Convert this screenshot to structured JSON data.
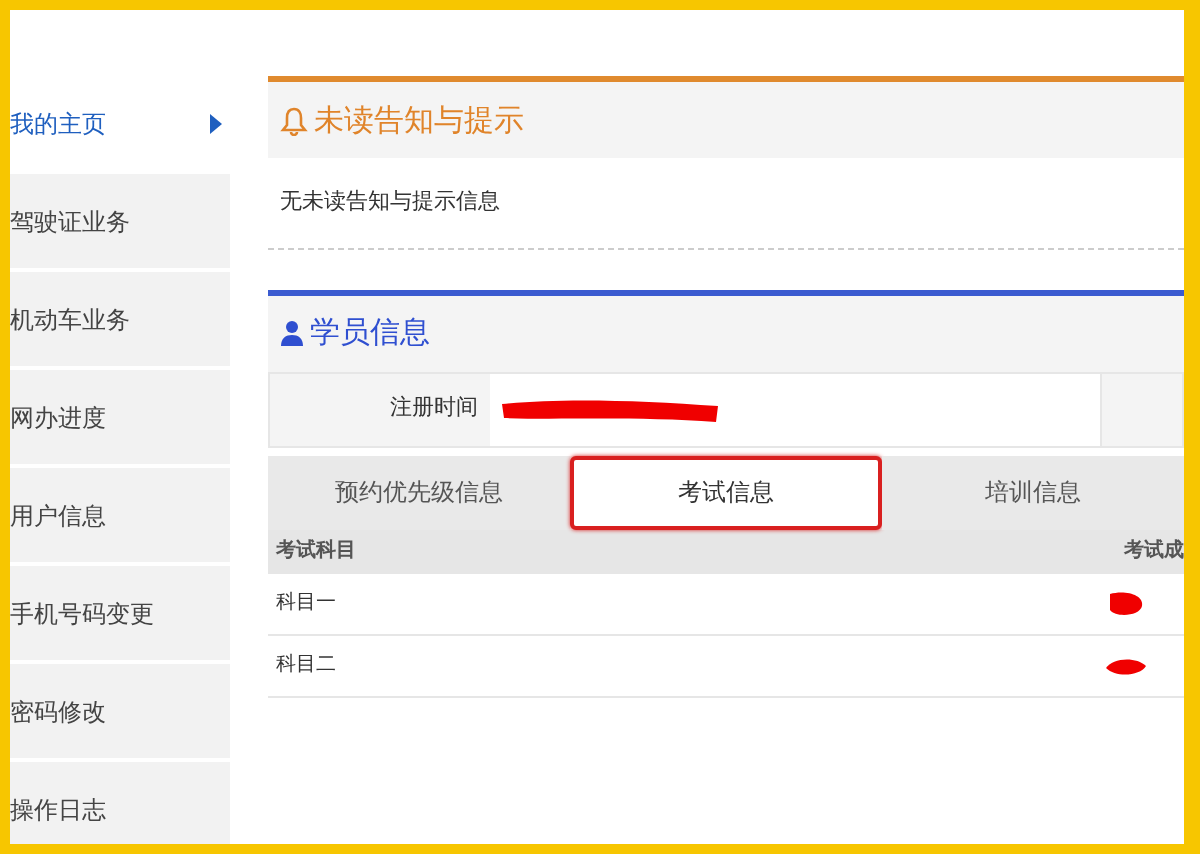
{
  "sidebar": {
    "items": [
      {
        "label": "我的主页",
        "selected": true
      },
      {
        "label": "驾驶证业务",
        "selected": false
      },
      {
        "label": "机动车业务",
        "selected": false
      },
      {
        "label": "网办进度",
        "selected": false
      },
      {
        "label": "用户信息",
        "selected": false
      },
      {
        "label": "手机号码变更",
        "selected": false
      },
      {
        "label": "密码修改",
        "selected": false
      },
      {
        "label": "操作日志",
        "selected": false
      }
    ]
  },
  "notices": {
    "title": "未读告知与提示",
    "message": "无未读告知与提示信息"
  },
  "student": {
    "title": "学员信息",
    "fields": [
      {
        "label": "注册时间",
        "redacted": true
      }
    ],
    "tabs": [
      {
        "label": "预约优先级信息",
        "selected": false,
        "highlighted": false
      },
      {
        "label": "考试信息",
        "selected": true,
        "highlighted": true
      },
      {
        "label": "培训信息",
        "selected": false,
        "highlighted": false
      }
    ],
    "table": {
      "columns": [
        "考试科目",
        "考试成"
      ],
      "rows": [
        {
          "subject": "科目一",
          "score_redacted": true
        },
        {
          "subject": "科目二",
          "score_redacted": true
        }
      ]
    }
  }
}
